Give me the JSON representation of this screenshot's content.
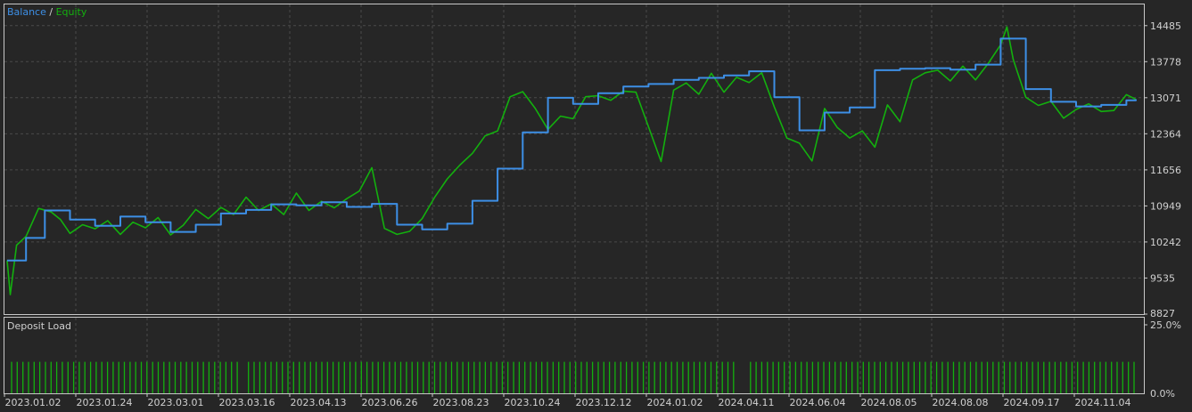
{
  "chart_data": [
    {
      "type": "line",
      "legend": {
        "balance": "Balance",
        "separator": " / ",
        "equity": "Equity",
        "placement": "top-left"
      },
      "colors": {
        "balance": "#3d8fe6",
        "equity": "#13b00e",
        "background": "#262626",
        "grid": "#4a4a4a",
        "frame": "#c8c8c8",
        "text": "#d0d0d0"
      },
      "ylim": [
        8827,
        14900
      ],
      "yticks": [
        "14485",
        "13778",
        "13071",
        "12364",
        "11656",
        "10949",
        "10242",
        "9535",
        "8827"
      ],
      "ytick_values": [
        14485,
        13778,
        13071,
        12364,
        11656,
        10949,
        10242,
        9535,
        8827
      ],
      "xticks": [
        "2023.01.02",
        "2023.01.24",
        "2023.03.01",
        "2023.03.16",
        "2023.04.13",
        "2023.06.26",
        "2023.08.23",
        "2023.10.24",
        "2023.12.12",
        "2024.01.02",
        "2024.04.11",
        "2024.06.04",
        "2024.08.05",
        "2024.08.08",
        "2024.09.17",
        "2024.11.04"
      ],
      "x_count": 360,
      "grid": true,
      "series": [
        {
          "name": "Balance",
          "x": [
            0,
            6,
            12,
            20,
            28,
            36,
            44,
            52,
            60,
            68,
            76,
            84,
            92,
            100,
            108,
            116,
            124,
            132,
            140,
            148,
            156,
            164,
            172,
            180,
            188,
            196,
            204,
            212,
            220,
            228,
            236,
            244,
            252,
            260,
            268,
            276,
            284,
            292,
            300,
            308,
            316,
            324,
            332,
            340,
            348,
            356,
            359
          ],
          "values": [
            9880,
            10320,
            10860,
            10680,
            10560,
            10740,
            10630,
            10440,
            10580,
            10800,
            10870,
            10980,
            10960,
            11020,
            10930,
            10990,
            10580,
            10490,
            10600,
            11050,
            11680,
            12390,
            13070,
            12950,
            13160,
            13290,
            13340,
            13420,
            13460,
            13510,
            13590,
            13080,
            12430,
            12780,
            12880,
            13610,
            13640,
            13650,
            13620,
            13720,
            14230,
            13240,
            12990,
            12900,
            12930,
            13020,
            13040
          ]
        },
        {
          "name": "Equity",
          "x": [
            0,
            1,
            3,
            6,
            10,
            14,
            17,
            20,
            24,
            28,
            32,
            36,
            40,
            44,
            48,
            52,
            56,
            60,
            64,
            68,
            72,
            76,
            80,
            84,
            88,
            92,
            96,
            100,
            104,
            108,
            112,
            116,
            120,
            124,
            128,
            132,
            136,
            140,
            144,
            148,
            152,
            156,
            160,
            164,
            168,
            172,
            176,
            180,
            184,
            188,
            192,
            196,
            200,
            204,
            208,
            212,
            216,
            220,
            224,
            228,
            232,
            236,
            240,
            244,
            248,
            252,
            256,
            260,
            264,
            268,
            272,
            276,
            280,
            284,
            288,
            292,
            296,
            300,
            304,
            308,
            312,
            316,
            318,
            320,
            324,
            328,
            332,
            336,
            340,
            344,
            348,
            352,
            356,
            359
          ],
          "values": [
            9880,
            9210,
            10180,
            10350,
            10900,
            10830,
            10680,
            10410,
            10580,
            10500,
            10660,
            10390,
            10630,
            10520,
            10720,
            10380,
            10570,
            10880,
            10700,
            10920,
            10780,
            11120,
            10860,
            10990,
            10780,
            11200,
            10860,
            11040,
            10910,
            11090,
            11240,
            11700,
            10510,
            10390,
            10450,
            10700,
            11120,
            11480,
            11750,
            11980,
            12320,
            12420,
            13090,
            13190,
            12860,
            12450,
            12710,
            12660,
            13090,
            13110,
            13020,
            13200,
            13180,
            12500,
            11820,
            13220,
            13360,
            13140,
            13550,
            13180,
            13470,
            13370,
            13560,
            12890,
            12280,
            12180,
            11830,
            12860,
            12490,
            12280,
            12420,
            12100,
            12930,
            12600,
            13420,
            13560,
            13610,
            13400,
            13690,
            13420,
            13740,
            14110,
            14460,
            13820,
            13080,
            12920,
            13000,
            12670,
            12840,
            12950,
            12800,
            12820,
            13130,
            13040
          ]
        }
      ]
    },
    {
      "type": "bar",
      "title": "Deposit Load",
      "yticks": [
        "25.0%",
        "0.0%"
      ],
      "ylim": [
        0,
        25
      ],
      "bar_color": "#13b00e",
      "bar_value": 11.5,
      "bar_count": 200
    }
  ]
}
